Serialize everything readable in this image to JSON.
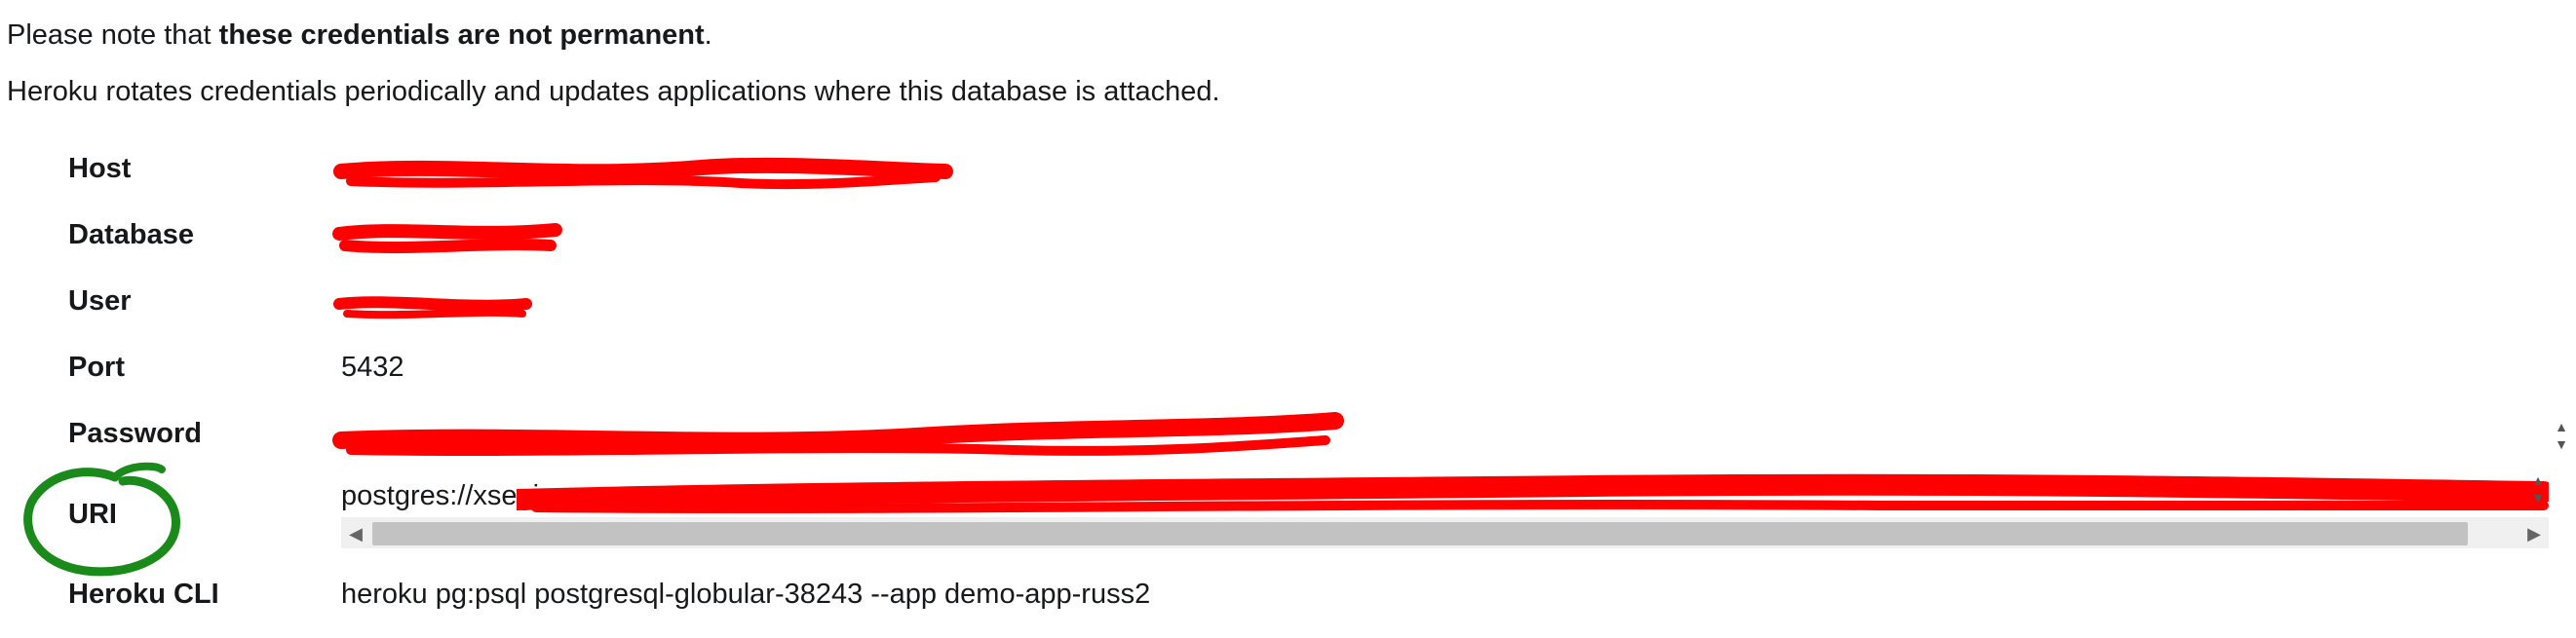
{
  "notice": {
    "prefix": "Please note that ",
    "emphasis": "these credentials are not permanent",
    "suffix": ".",
    "rotation": "Heroku rotates credentials periodically and updates applications where this database is attached."
  },
  "credentials": {
    "host_label": "Host",
    "host_value": "",
    "database_label": "Database",
    "database_value": "",
    "user_label": "User",
    "user_value": "",
    "port_label": "Port",
    "port_value": "5432",
    "password_label": "Password",
    "password_value": "",
    "uri_label": "URI",
    "uri_value": "postgres://xsegi",
    "cli_label": "Heroku CLI",
    "cli_value": "heroku pg:psql postgresql-globular-38243 --app demo-app-russ2"
  },
  "colors": {
    "redaction": "#ff0000",
    "annotation_circle": "#1a8a1a",
    "scrollbar_thumb": "#c2c2c2"
  }
}
